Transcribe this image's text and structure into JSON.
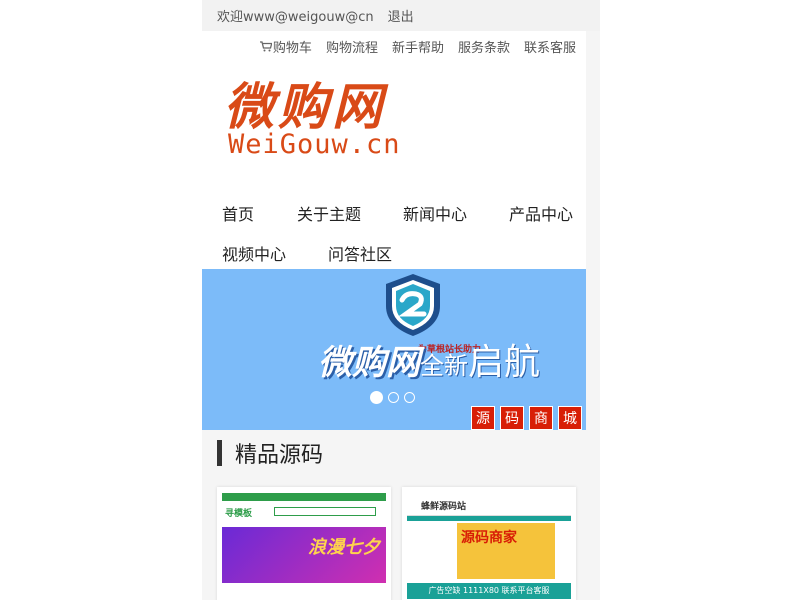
{
  "topbar": {
    "welcome": "欢迎www@weigouw@cn",
    "logout": "退出"
  },
  "toplinks": [
    {
      "label": "购物车",
      "icon": "cart-icon"
    },
    {
      "label": "购物流程"
    },
    {
      "label": "新手帮助"
    },
    {
      "label": "服务条款"
    },
    {
      "label": "联系客服"
    }
  ],
  "logo": {
    "cn": "微购网",
    "en": "WeiGouw.cn"
  },
  "nav": {
    "row1": [
      "首页",
      "关于主题",
      "新闻中心",
      "产品中心"
    ],
    "row2": [
      "视频中心",
      "问答社区"
    ]
  },
  "banner": {
    "tag": "为草根站长助力",
    "title_a": "微购网",
    "title_b": "全新",
    "title_c": "启航",
    "badges": [
      "源",
      "码",
      "商",
      "城"
    ],
    "slides_total": 3,
    "slide_active": 1
  },
  "section": {
    "title": "精品源码"
  },
  "cards": [
    {
      "thumb_logo": "寻模板",
      "thumb_promo": "浪漫七夕"
    },
    {
      "thumb_logo": "蜂鲜源码站",
      "thumb_promo": "源码商家",
      "thumb_ad": "广告空缺 1111X80 联系平台客服"
    }
  ],
  "colors": {
    "brand": "#d94a17",
    "banner_bg": "#7cbbf9",
    "badge": "#d81e06",
    "page_bg": "#f5f5f5"
  }
}
